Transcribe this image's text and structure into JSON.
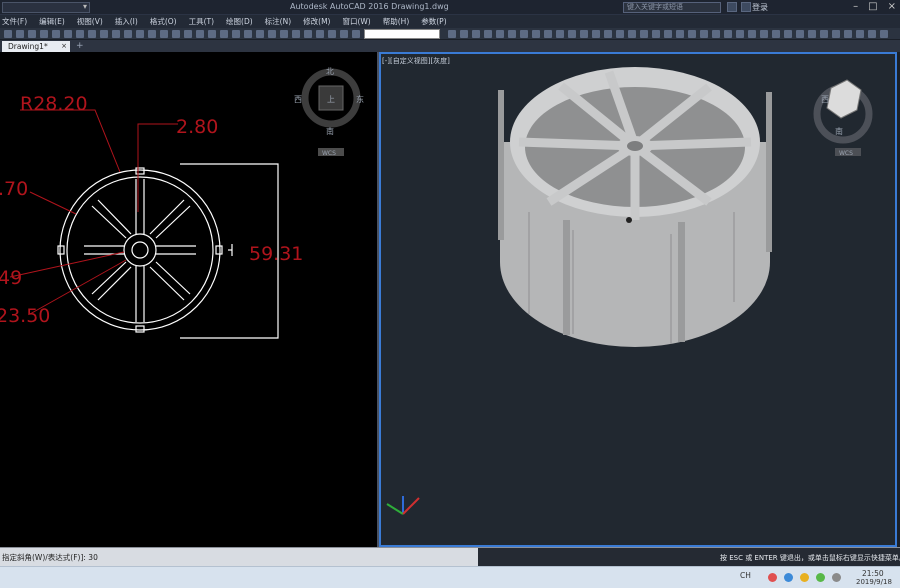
{
  "titlebar": {
    "app_title": "Autodesk AutoCAD 2016    Drawing1.dwg",
    "search_placeholder": "键入关键字或短语",
    "login_label": "登录"
  },
  "menu": [
    "文件(F)",
    "编辑(E)",
    "视图(V)",
    "插入(I)",
    "格式(O)",
    "工具(T)",
    "绘图(D)",
    "标注(N)",
    "修改(M)",
    "窗口(W)",
    "帮助(H)",
    "参数(P)"
  ],
  "tabs": {
    "active": "Drawing1*",
    "close": "×",
    "add": "+"
  },
  "viewport_left": {
    "dimensions": {
      "radius": "R28.20",
      "width_top": "2.80",
      "left_mid": ".70",
      "inner": "49",
      "left_low": "23.50",
      "height": "59.31"
    },
    "viewcube": {
      "north": "北",
      "south": "南",
      "east": "东",
      "west": "西",
      "top": "上",
      "wcs": "WCS"
    }
  },
  "viewport_right": {
    "label": "[-][自定义视图][灰度]",
    "viewcube": {
      "west": "西",
      "south": "南",
      "wcs": "WCS"
    }
  },
  "commandline": {
    "input_text": "指定斜角(W)/表达式(F)]: 30",
    "prompt_text": "按 ESC 或 ENTER 键退出，或单击鼠标右键显示快捷菜单。"
  },
  "taskbar": {
    "lang": "CH",
    "time": "21:50",
    "date": "2019/9/18"
  },
  "colors": {
    "dimension": "#b0141c",
    "wireframe": "#ffffff",
    "model_fill": "#bfc0c1",
    "viewport_active_border": "#3a7bd5"
  }
}
